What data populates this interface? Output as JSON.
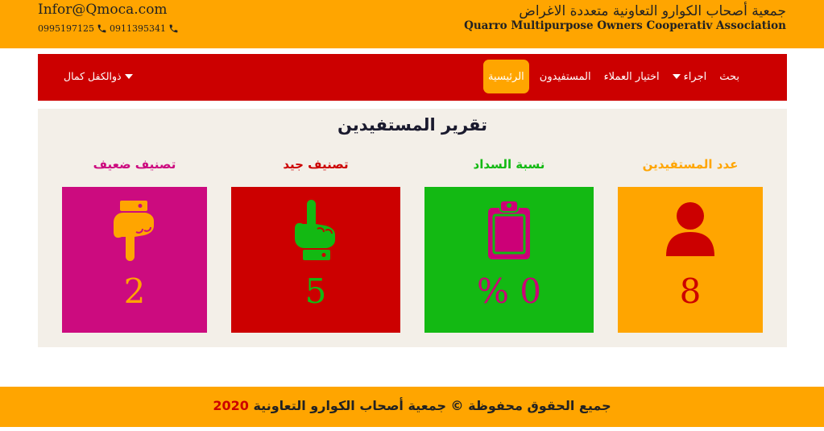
{
  "header": {
    "email": "Infor@Qmoca.com",
    "phones": [
      "0911395341",
      "0995197125"
    ],
    "org_name_ar": "جمعية أصحاب الكوارو التعاونية متعددة الاغراض",
    "org_name_en": "Quarro Multipurpose Owners Cooperativ Association"
  },
  "nav": {
    "items": [
      {
        "label": "الرئيسية",
        "active": true
      },
      {
        "label": "المستفيدون"
      },
      {
        "label": "اختيار العملاء"
      },
      {
        "label": "اجراء",
        "dropdown": true
      },
      {
        "label": "بحث"
      }
    ],
    "user": "ذوالكفل كمال"
  },
  "report": {
    "title": "تقرير المستفيدين",
    "cards": [
      {
        "label": "عدد المستفيدين",
        "value": "8",
        "icon": "user-icon",
        "bg": "#ffa500",
        "label_color": "#ffa500",
        "value_color": "#cc0000",
        "icon_color": "#cc0000"
      },
      {
        "label": "نسبة السداد",
        "value": "% 0",
        "icon": "clipboard-icon",
        "bg": "#13b913",
        "label_color": "#13b913",
        "value_color": "#cc0077",
        "icon_color": "#cc0077"
      },
      {
        "label": "تصنيف جيد",
        "value": "5",
        "icon": "hand-point-up-icon",
        "bg": "#cc0000",
        "label_color": "#cc0000",
        "value_color": "#13b913",
        "icon_color": "#13b913"
      },
      {
        "label": "تصنيف ضعيف",
        "value": "2",
        "icon": "hand-point-down-icon",
        "bg": "#cc0b7f",
        "label_color": "#cc0b7f",
        "value_color": "#ffa500",
        "icon_color": "#ffa500"
      }
    ]
  },
  "footer": {
    "text": "جميع الحقوق محفوظة © جمعية أصحاب الكوارو التعاونية",
    "year": "2020"
  },
  "colors": {
    "orange": "#ffa500",
    "red": "#cc0000",
    "green": "#13b913",
    "magenta": "#cc0b7f",
    "panel_bg": "#f3efe8"
  }
}
